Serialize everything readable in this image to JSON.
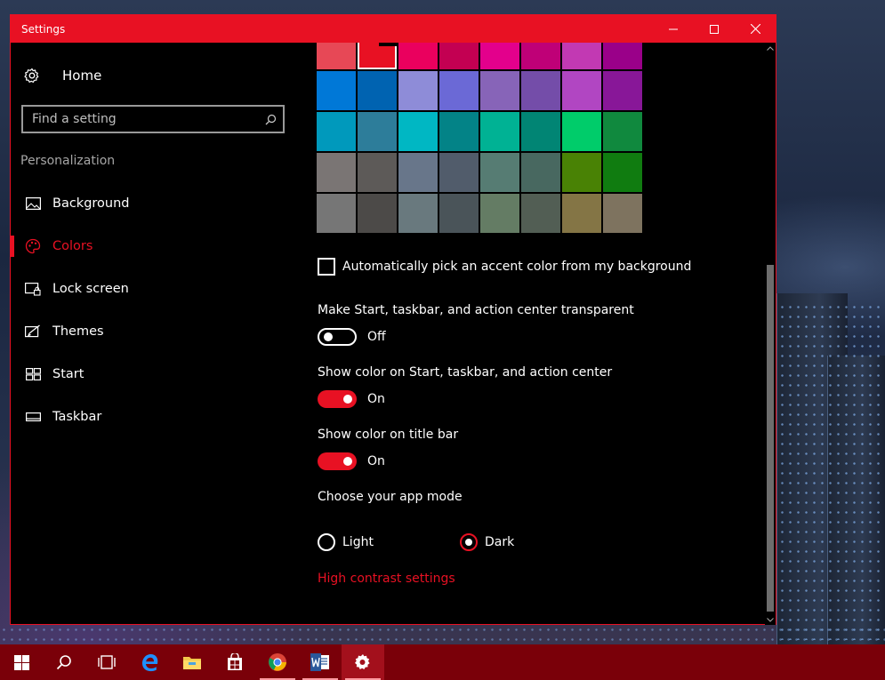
{
  "window": {
    "title": "Settings",
    "accent_color": "#e81123",
    "caption_buttons": [
      "minimize-icon",
      "maximize-icon",
      "close-icon"
    ]
  },
  "sidebar": {
    "home_label": "Home",
    "search_placeholder": "Find a setting",
    "section_label": "Personalization",
    "items": [
      {
        "label": "Background",
        "icon": "picture-icon",
        "active": false
      },
      {
        "label": "Colors",
        "icon": "palette-icon",
        "active": true
      },
      {
        "label": "Lock screen",
        "icon": "lock-screen-icon",
        "active": false
      },
      {
        "label": "Themes",
        "icon": "themes-icon",
        "active": false
      },
      {
        "label": "Start",
        "icon": "start-tiles-icon",
        "active": false
      },
      {
        "label": "Taskbar",
        "icon": "taskbar-icon",
        "active": false
      }
    ]
  },
  "colors": {
    "swatches": [
      [
        "#e74856",
        "#e81123",
        "#ea005e",
        "#c30052",
        "#e3008c",
        "#bf0077",
        "#c239b3",
        "#9a0089"
      ],
      [
        "#0078d7",
        "#0063b1",
        "#8e8cd8",
        "#6b69d6",
        "#8764b8",
        "#744da9",
        "#b146c2",
        "#881798"
      ],
      [
        "#0099bc",
        "#2d7d9a",
        "#00b7c3",
        "#038387",
        "#00b294",
        "#018574",
        "#00cc6a",
        "#10893e"
      ],
      [
        "#7a7574",
        "#5d5a58",
        "#68768a",
        "#515c6b",
        "#567c73",
        "#486860",
        "#498205",
        "#107c10"
      ],
      [
        "#767676",
        "#4c4a48",
        "#69797e",
        "#4a5459",
        "#647c64",
        "#525e54",
        "#847545",
        "#7e735f"
      ]
    ],
    "selected_swatch": "#e81123",
    "auto_pick_label": "Automatically pick an accent color from my background",
    "auto_pick_checked": false,
    "transparent_label": "Make Start, taskbar, and action center transparent",
    "transparent_state": "Off",
    "show_start_label": "Show color on Start, taskbar, and action center",
    "show_start_state": "On",
    "show_titlebar_label": "Show color on title bar",
    "show_titlebar_state": "On",
    "app_mode_label": "Choose your app mode",
    "app_mode_options": [
      "Light",
      "Dark"
    ],
    "app_mode_selected": "Dark",
    "high_contrast_link": "High contrast settings"
  },
  "taskbar": {
    "items": [
      {
        "icon": "windows-start-icon",
        "running": false,
        "active": false
      },
      {
        "icon": "search-icon",
        "running": false,
        "active": false
      },
      {
        "icon": "task-view-icon",
        "running": false,
        "active": false
      },
      {
        "icon": "edge-browser-icon",
        "running": false,
        "active": false
      },
      {
        "icon": "file-explorer-icon",
        "running": false,
        "active": false
      },
      {
        "icon": "store-icon",
        "running": false,
        "active": false
      },
      {
        "icon": "chrome-icon",
        "running": true,
        "active": false
      },
      {
        "icon": "word-icon",
        "running": true,
        "active": false
      },
      {
        "icon": "settings-gear-icon",
        "running": true,
        "active": true
      }
    ]
  }
}
